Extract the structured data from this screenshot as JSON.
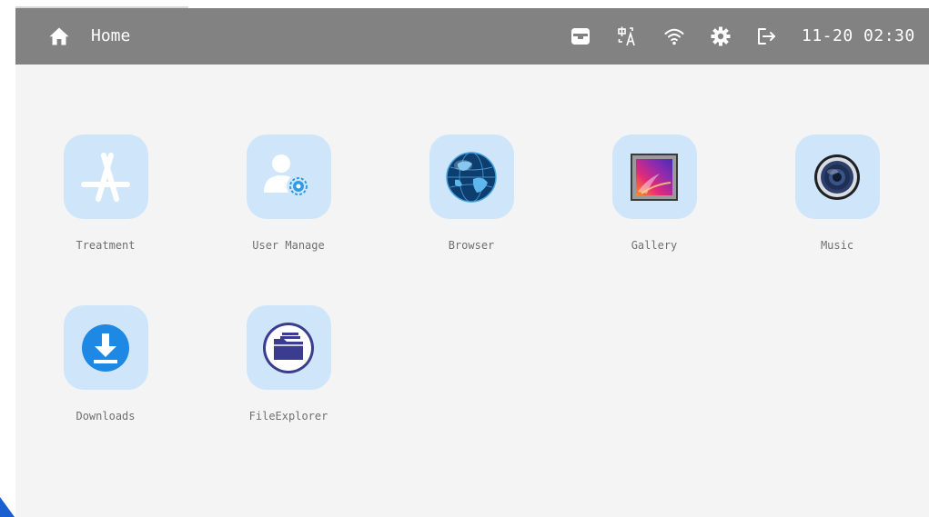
{
  "header": {
    "title": "Home",
    "clock": "11-20 02:30",
    "icons": [
      "home-icon",
      "tray-icon",
      "language-icon",
      "wifi-icon",
      "gear-icon",
      "logout-icon"
    ]
  },
  "apps": [
    {
      "label": "Treatment",
      "icon": "app-store-icon"
    },
    {
      "label": "User Manage",
      "icon": "user-settings-icon"
    },
    {
      "label": "Browser",
      "icon": "globe-icon"
    },
    {
      "label": "Gallery",
      "icon": "picture-icon"
    },
    {
      "label": "Music",
      "icon": "speaker-icon"
    },
    {
      "label": "Downloads",
      "icon": "download-icon"
    },
    {
      "label": "FileExplorer",
      "icon": "folder-icon"
    }
  ],
  "colors": {
    "topbar": "#828282",
    "background": "#f4f4f4",
    "tile": "#cfe6fa",
    "label": "#707070",
    "download_blue": "#1e88e5",
    "folder_indigo": "#3a3d8f",
    "edge_accent": "#1a5fd0"
  }
}
